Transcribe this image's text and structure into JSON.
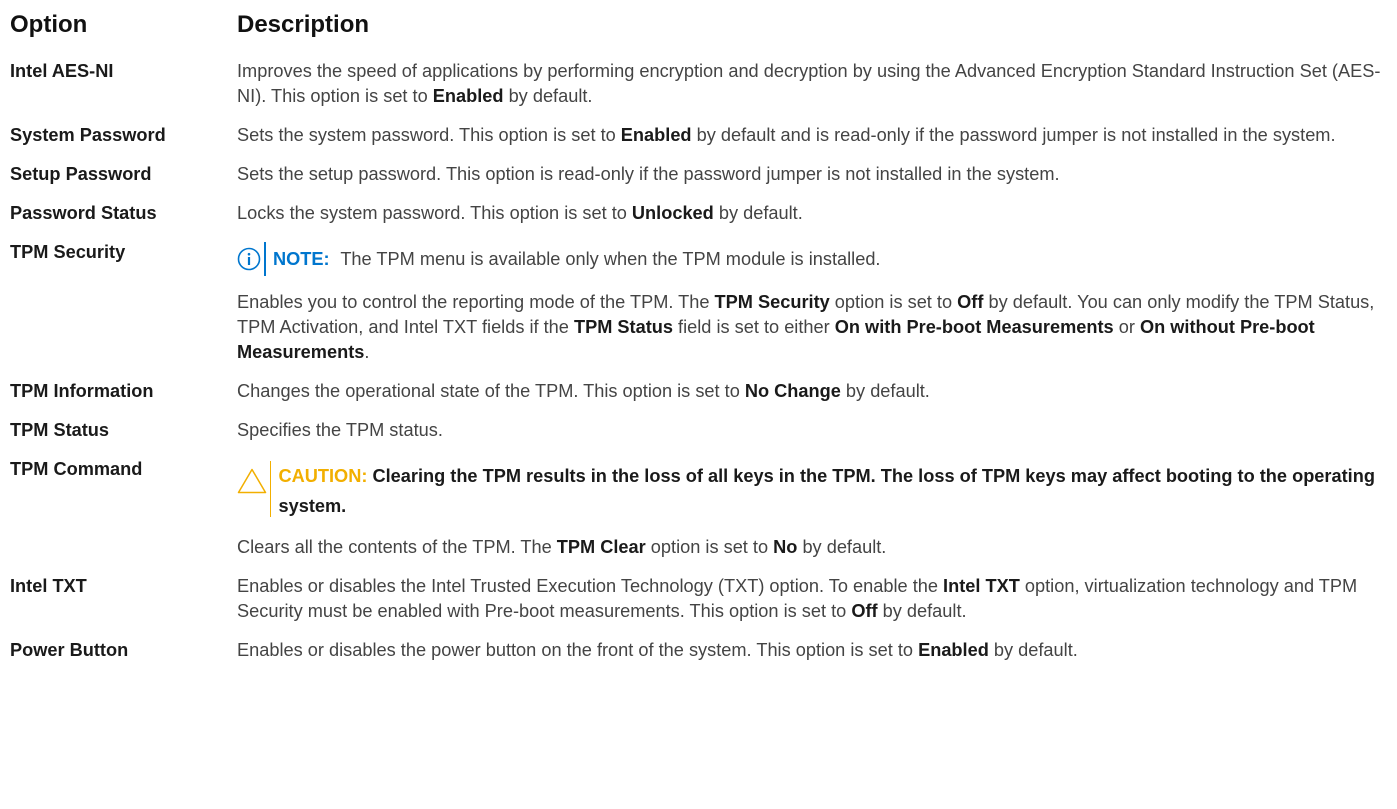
{
  "header": {
    "option": "Option",
    "description": "Description"
  },
  "rows": {
    "aes": {
      "option": "Intel AES-NI",
      "d1": "Improves the speed of applications by performing encryption and decryption by using the Advanced Encryption Standard Instruction Set (AES-NI). This option is set to ",
      "b1": "Enabled",
      "d2": " by default."
    },
    "syspw": {
      "option": "System Password",
      "d1": "Sets the system password. This option is set to ",
      "b1": "Enabled",
      "d2": " by default and is read-only if the password jumper is not installed in the system."
    },
    "setuppw": {
      "option": "Setup Password",
      "d1": "Sets the setup password. This option is read-only if the password jumper is not installed in the system."
    },
    "pwstatus": {
      "option": "Password Status",
      "d1": "Locks the system password. This option is set to ",
      "b1": "Unlocked",
      "d2": " by default."
    },
    "tpmsec": {
      "option": "TPM Security",
      "note_label": "NOTE:",
      "note_text": " The TPM menu is available only when the TPM module is installed.",
      "d1": "Enables you to control the reporting mode of the TPM. The ",
      "b1": "TPM Security",
      "d2": " option is set to ",
      "b2": "Off",
      "d3": " by default. You can only modify the TPM Status, TPM Activation, and Intel TXT fields if the ",
      "b3": "TPM Status",
      "d4": " field is set to either ",
      "b4": "On with Pre-boot Measurements",
      "d5": " or ",
      "b5": "On without Pre-boot Measurements",
      "d6": "."
    },
    "tpminfo": {
      "option": "TPM Information",
      "d1": "Changes the operational state of the TPM. This option is set to ",
      "b1": "No Change",
      "d2": " by default."
    },
    "tpmstatus": {
      "option": "TPM Status",
      "d1": "Specifies the TPM status."
    },
    "tpmcmd": {
      "option": "TPM Command",
      "caution_label": "CAUTION:",
      "caution_text": " Clearing the TPM results in the loss of all keys in the TPM. The loss of TPM keys may affect booting to the operating system.",
      "d1": "Clears all the contents of the TPM. The ",
      "b1": "TPM Clear",
      "d2": " option is set to ",
      "b2": "No",
      "d3": " by default."
    },
    "txt": {
      "option": "Intel TXT",
      "d1": "Enables or disables the Intel Trusted Execution Technology (TXT) option. To enable the ",
      "b1": "Intel TXT",
      "d2": " option, virtualization technology and TPM Security must be enabled with Pre-boot measurements. This option is set to ",
      "b2": "Off",
      "d3": " by default."
    },
    "power": {
      "option": "Power Button",
      "d1": "Enables or disables the power button on the front of the system. This option is set to ",
      "b1": "Enabled",
      "d2": " by default."
    }
  },
  "colors": {
    "note_accent": "#0076ce",
    "caution_accent": "#f2af00",
    "text": "#444444"
  },
  "icons": {
    "note": "info-circle-icon",
    "caution": "warning-triangle-icon"
  }
}
